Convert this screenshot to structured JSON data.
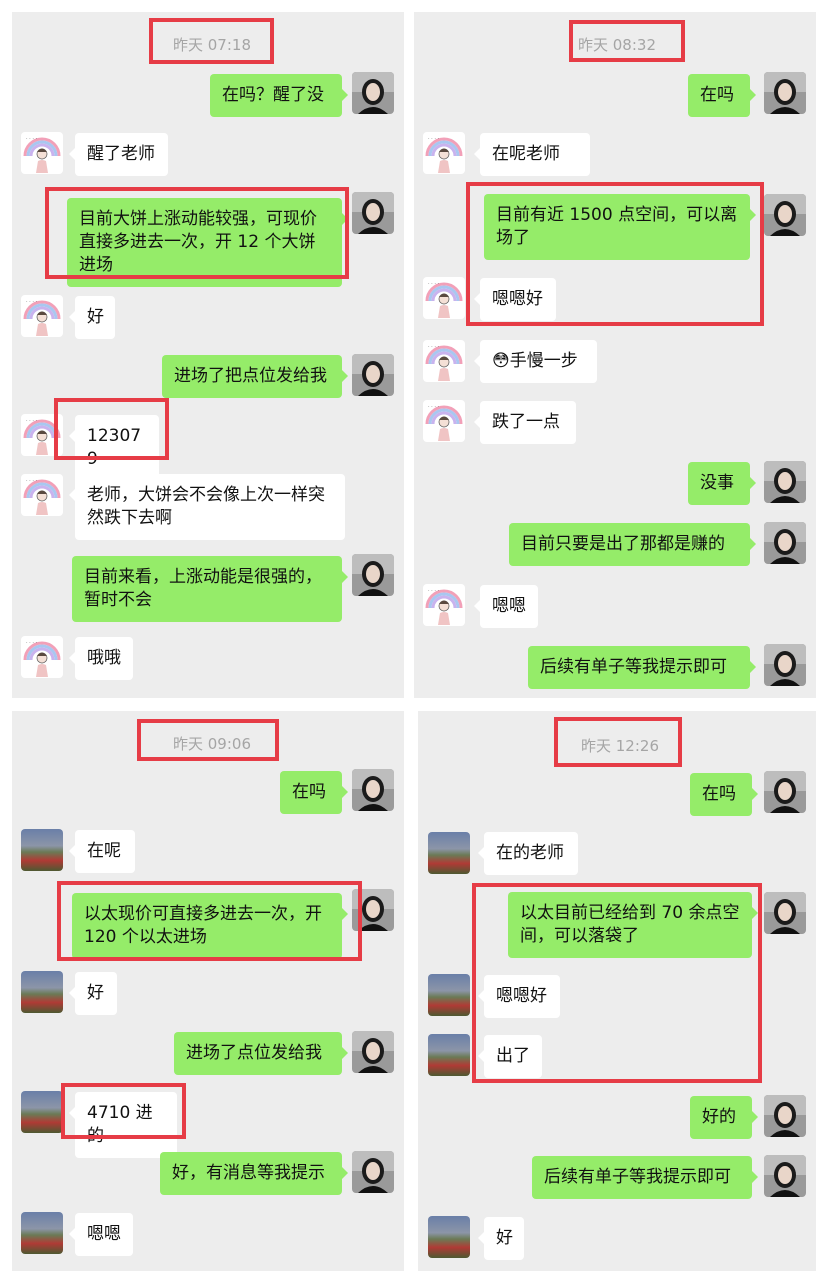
{
  "colors": {
    "me_bubble": "#95ec69",
    "other_bubble": "#ffffff",
    "panel_bg": "#ededed",
    "highlight": "#e63c46"
  },
  "panel1": {
    "timestamp": "昨天 07:18",
    "messages": [
      {
        "from": "me",
        "text": "在吗？醒了没"
      },
      {
        "from": "other",
        "text": "醒了老师"
      },
      {
        "from": "me",
        "text": "目前大饼上涨动能较强，可现价直接多进去一次，开 12 个大饼进场"
      },
      {
        "from": "other",
        "text": "好"
      },
      {
        "from": "me",
        "text": "进场了把点位发给我"
      },
      {
        "from": "other",
        "text": "123079"
      },
      {
        "from": "other",
        "text": "老师，大饼会不会像上次一样突然跌下去啊"
      },
      {
        "from": "me",
        "text": "目前来看，上涨动能是很强的，暂时不会"
      },
      {
        "from": "other",
        "text": "哦哦"
      }
    ]
  },
  "panel2": {
    "timestamp": "昨天 08:32",
    "messages": [
      {
        "from": "me",
        "text": "在吗"
      },
      {
        "from": "other",
        "text": "在呢老师"
      },
      {
        "from": "me",
        "text": "目前有近 1500 点空间，可以离场了"
      },
      {
        "from": "other",
        "text": "嗯嗯好"
      },
      {
        "from": "other",
        "text": "😳手慢一步"
      },
      {
        "from": "other",
        "text": "跌了一点"
      },
      {
        "from": "me",
        "text": "没事"
      },
      {
        "from": "me",
        "text": "目前只要是出了那都是赚的"
      },
      {
        "from": "other",
        "text": "嗯嗯"
      },
      {
        "from": "me",
        "text": "后续有单子等我提示即可"
      }
    ]
  },
  "panel3": {
    "timestamp": "昨天 09:06",
    "messages": [
      {
        "from": "me",
        "text": "在吗"
      },
      {
        "from": "other",
        "text": "在呢"
      },
      {
        "from": "me",
        "text": "以太现价可直接多进去一次，开 120 个以太进场"
      },
      {
        "from": "other",
        "text": "好"
      },
      {
        "from": "me",
        "text": "进场了点位发给我"
      },
      {
        "from": "other",
        "text": "4710 进的"
      },
      {
        "from": "me",
        "text": "好，有消息等我提示"
      },
      {
        "from": "other",
        "text": "嗯嗯"
      }
    ]
  },
  "panel4": {
    "timestamp": "昨天 12:26",
    "messages": [
      {
        "from": "me",
        "text": "在吗"
      },
      {
        "from": "other",
        "text": "在的老师"
      },
      {
        "from": "me",
        "text": "以太目前已经给到 70 余点空间，可以落袋了"
      },
      {
        "from": "other",
        "text": "嗯嗯好"
      },
      {
        "from": "other",
        "text": "出了"
      },
      {
        "from": "me",
        "text": "好的"
      },
      {
        "from": "me",
        "text": "后续有单子等我提示即可"
      },
      {
        "from": "other",
        "text": "好"
      }
    ]
  }
}
